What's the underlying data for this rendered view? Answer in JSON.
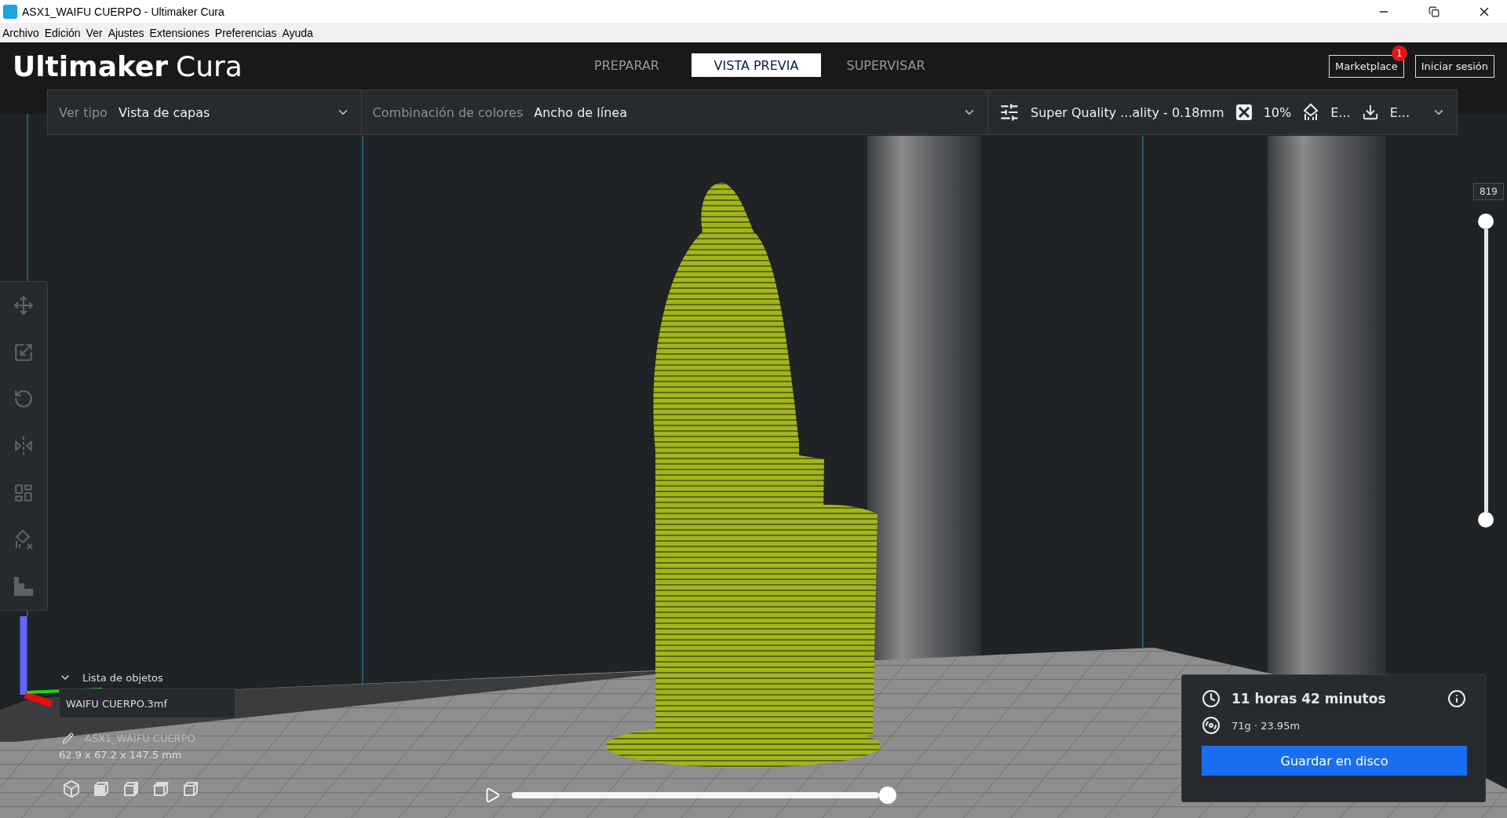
{
  "window": {
    "title": "ASX1_WAIFU CUERPO - Ultimaker Cura"
  },
  "menu_bar": [
    "Archivo",
    "Edición",
    "Ver",
    "Ajustes",
    "Extensiones",
    "Preferencias",
    "Ayuda"
  ],
  "header": {
    "logo": {
      "brand": "Ultimaker",
      "product": "Cura"
    },
    "tabs": [
      {
        "label": "PREPARAR",
        "selected": false
      },
      {
        "label": "VISTA PREVIA",
        "selected": true
      },
      {
        "label": "SUPERVISAR",
        "selected": false
      }
    ],
    "marketplace": {
      "label": "Marketplace",
      "badge": "1"
    },
    "sign_in": "Iniciar sesión"
  },
  "view_bar": {
    "view_type": {
      "label": "Ver tipo",
      "value": "Vista de capas"
    },
    "color_scheme": {
      "label": "Combinación de colores",
      "value": "Ancho de línea"
    },
    "print_settings": {
      "profile": "Super Quality ...ality - 0.18mm",
      "infill": "10%",
      "support": "E...",
      "adhesion": "E..."
    }
  },
  "layer_slider": {
    "reading": "819",
    "level": 1
  },
  "object_list": {
    "title": "Lista de objetos",
    "expanded": true,
    "items": [
      {
        "name": "WAIFU CUERPO.3mf"
      }
    ],
    "job_name": "ASX1_WAIFU CUERPO",
    "dimensions": "62.9 x 67.2 x 147.5 mm"
  },
  "simulation": {
    "level": 1
  },
  "print_info": {
    "time": "11 horas 42 minutos",
    "material": "71g · 23.95m",
    "button": "Guardar en disco"
  }
}
